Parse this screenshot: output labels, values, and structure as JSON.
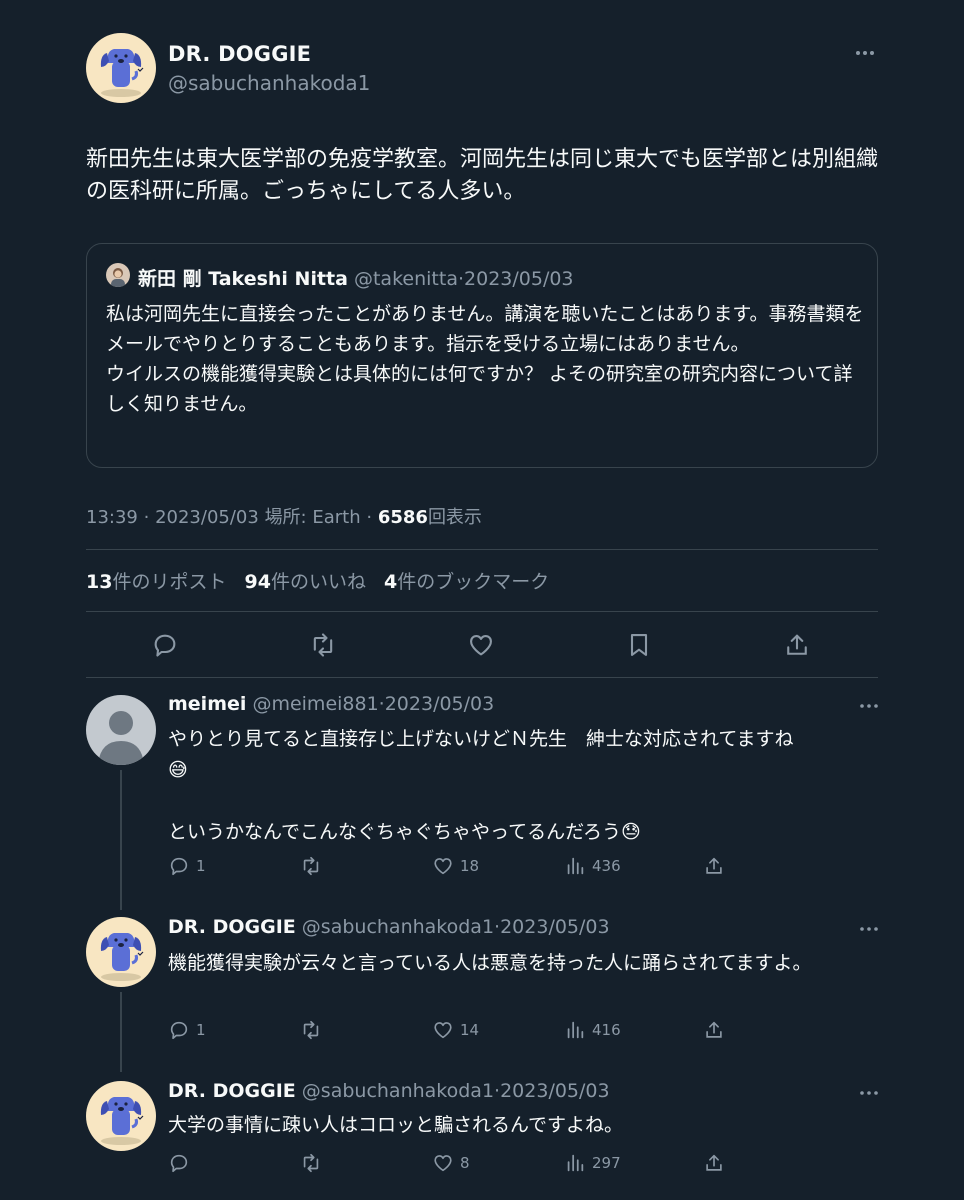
{
  "main_tweet": {
    "author_name": "DR. DOGGIE",
    "author_handle": "@sabuchanhakoda1",
    "text": "新田先生は東大医学部の免疫学教室。河岡先生は同じ東大でも医学部とは別組織の医科研に所属。ごっちゃにしてる人多い。",
    "quote": {
      "author_name": "新田 剛 Takeshi Nitta",
      "author_handle": "@takenitta",
      "date": "2023/05/03",
      "line1": "私は河岡先生に直接会ったことがありません。講演を聴いたことはあります。事務書類をメールでやりとりすることもあります。指示を受ける立場にはありません。",
      "line2": "ウイルスの機能獲得実験とは具体的には何ですか？ よその研究室の研究内容について詳しく知りません。"
    },
    "meta": {
      "time": "13:39",
      "date": "2023/05/03",
      "location": "場所: Earth",
      "views_count": "6586",
      "views_label": "回表示"
    },
    "stats": {
      "reposts_count": "13",
      "reposts_label": "件のリポスト",
      "likes_count": "94",
      "likes_label": "件のいいね",
      "bookmarks_count": "4",
      "bookmarks_label": "件のブックマーク"
    }
  },
  "replies": [
    {
      "author_name": "meimei",
      "author_handle": "@meimei881",
      "date": "2023/05/03",
      "text_line1": "やりとり見てると直接存じ上げないけどＮ先生　紳士な対応されてますね",
      "emoji1": "😅",
      "text_line2": "というかなんでこんなぐちゃぐちゃやってるんだろう",
      "emoji2": "😓",
      "replies": "1",
      "reposts": "",
      "likes": "18",
      "views": "436"
    },
    {
      "author_name": "DR. DOGGIE",
      "author_handle": "@sabuchanhakoda1",
      "date": "2023/05/03",
      "text": "機能獲得実験が云々と言っている人は悪意を持った人に踊らされてますよ。",
      "replies": "1",
      "reposts": "",
      "likes": "14",
      "views": "416"
    },
    {
      "author_name": "DR. DOGGIE",
      "author_handle": "@sabuchanhakoda1",
      "date": "2023/05/03",
      "text": "大学の事情に疎い人はコロッと騙されるんですよね。",
      "replies": "",
      "reposts": "",
      "likes": "8",
      "views": "297"
    }
  ],
  "separator": "·",
  "colors": {
    "background": "#15202b",
    "text": "#f7f9f9",
    "muted": "#8b98a5",
    "border": "#38444d",
    "avatar_bg": "#f8e6c2",
    "dog_blue": "#5b6fd6"
  }
}
